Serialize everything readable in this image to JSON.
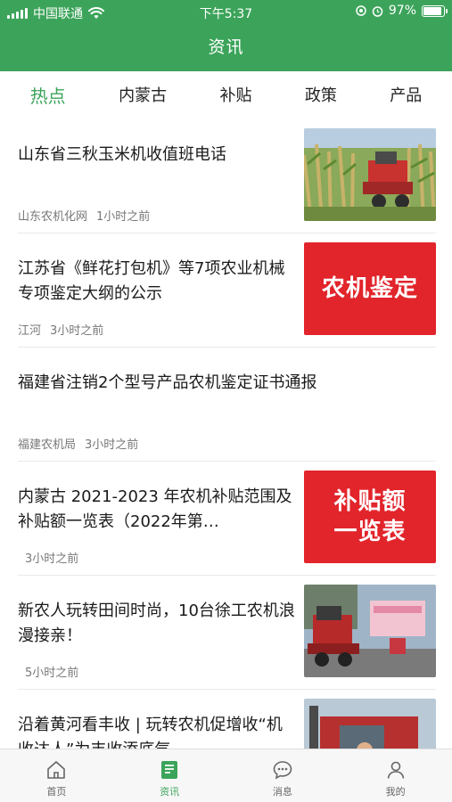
{
  "status_bar": {
    "carrier": "中国联通",
    "time": "下午5:37",
    "battery": "97%"
  },
  "header": {
    "title": "资讯"
  },
  "tabs": [
    "热点",
    "内蒙古",
    "补贴",
    "政策",
    "产品"
  ],
  "feed": [
    {
      "title": "山东省三秋玉米机收值班电话",
      "source": "山东农机化网",
      "time": "1小时之前",
      "image": "corn-harvester"
    },
    {
      "title": "江苏省《鲜花打包机》等7项农业机械专项鉴定大纲的公示",
      "source": "江河",
      "time": "3小时之前",
      "image_text": "农机鉴定"
    },
    {
      "title": "福建省注销2个型号产品农机鉴定证书通报",
      "source": "福建农机局",
      "time": "3小时之前"
    },
    {
      "title": "内蒙古 2021-2023 年农机补贴范围及补贴额一览表（2022年第…",
      "source": "",
      "time": "3小时之前",
      "image_text_1": "补贴额",
      "image_text_2": "一览表"
    },
    {
      "title": "新农人玩转田间时尚，10台徐工农机浪漫接亲！",
      "source": "",
      "time": "5小时之前",
      "image": "harvester-wedding"
    },
    {
      "title": "沿着黄河看丰收 | 玩转农机促增收“机收达人”为丰收添底气",
      "source": "",
      "time": "",
      "image": "farmer-machine"
    }
  ],
  "tabbar": [
    "首页",
    "资讯",
    "消息",
    "我的"
  ]
}
